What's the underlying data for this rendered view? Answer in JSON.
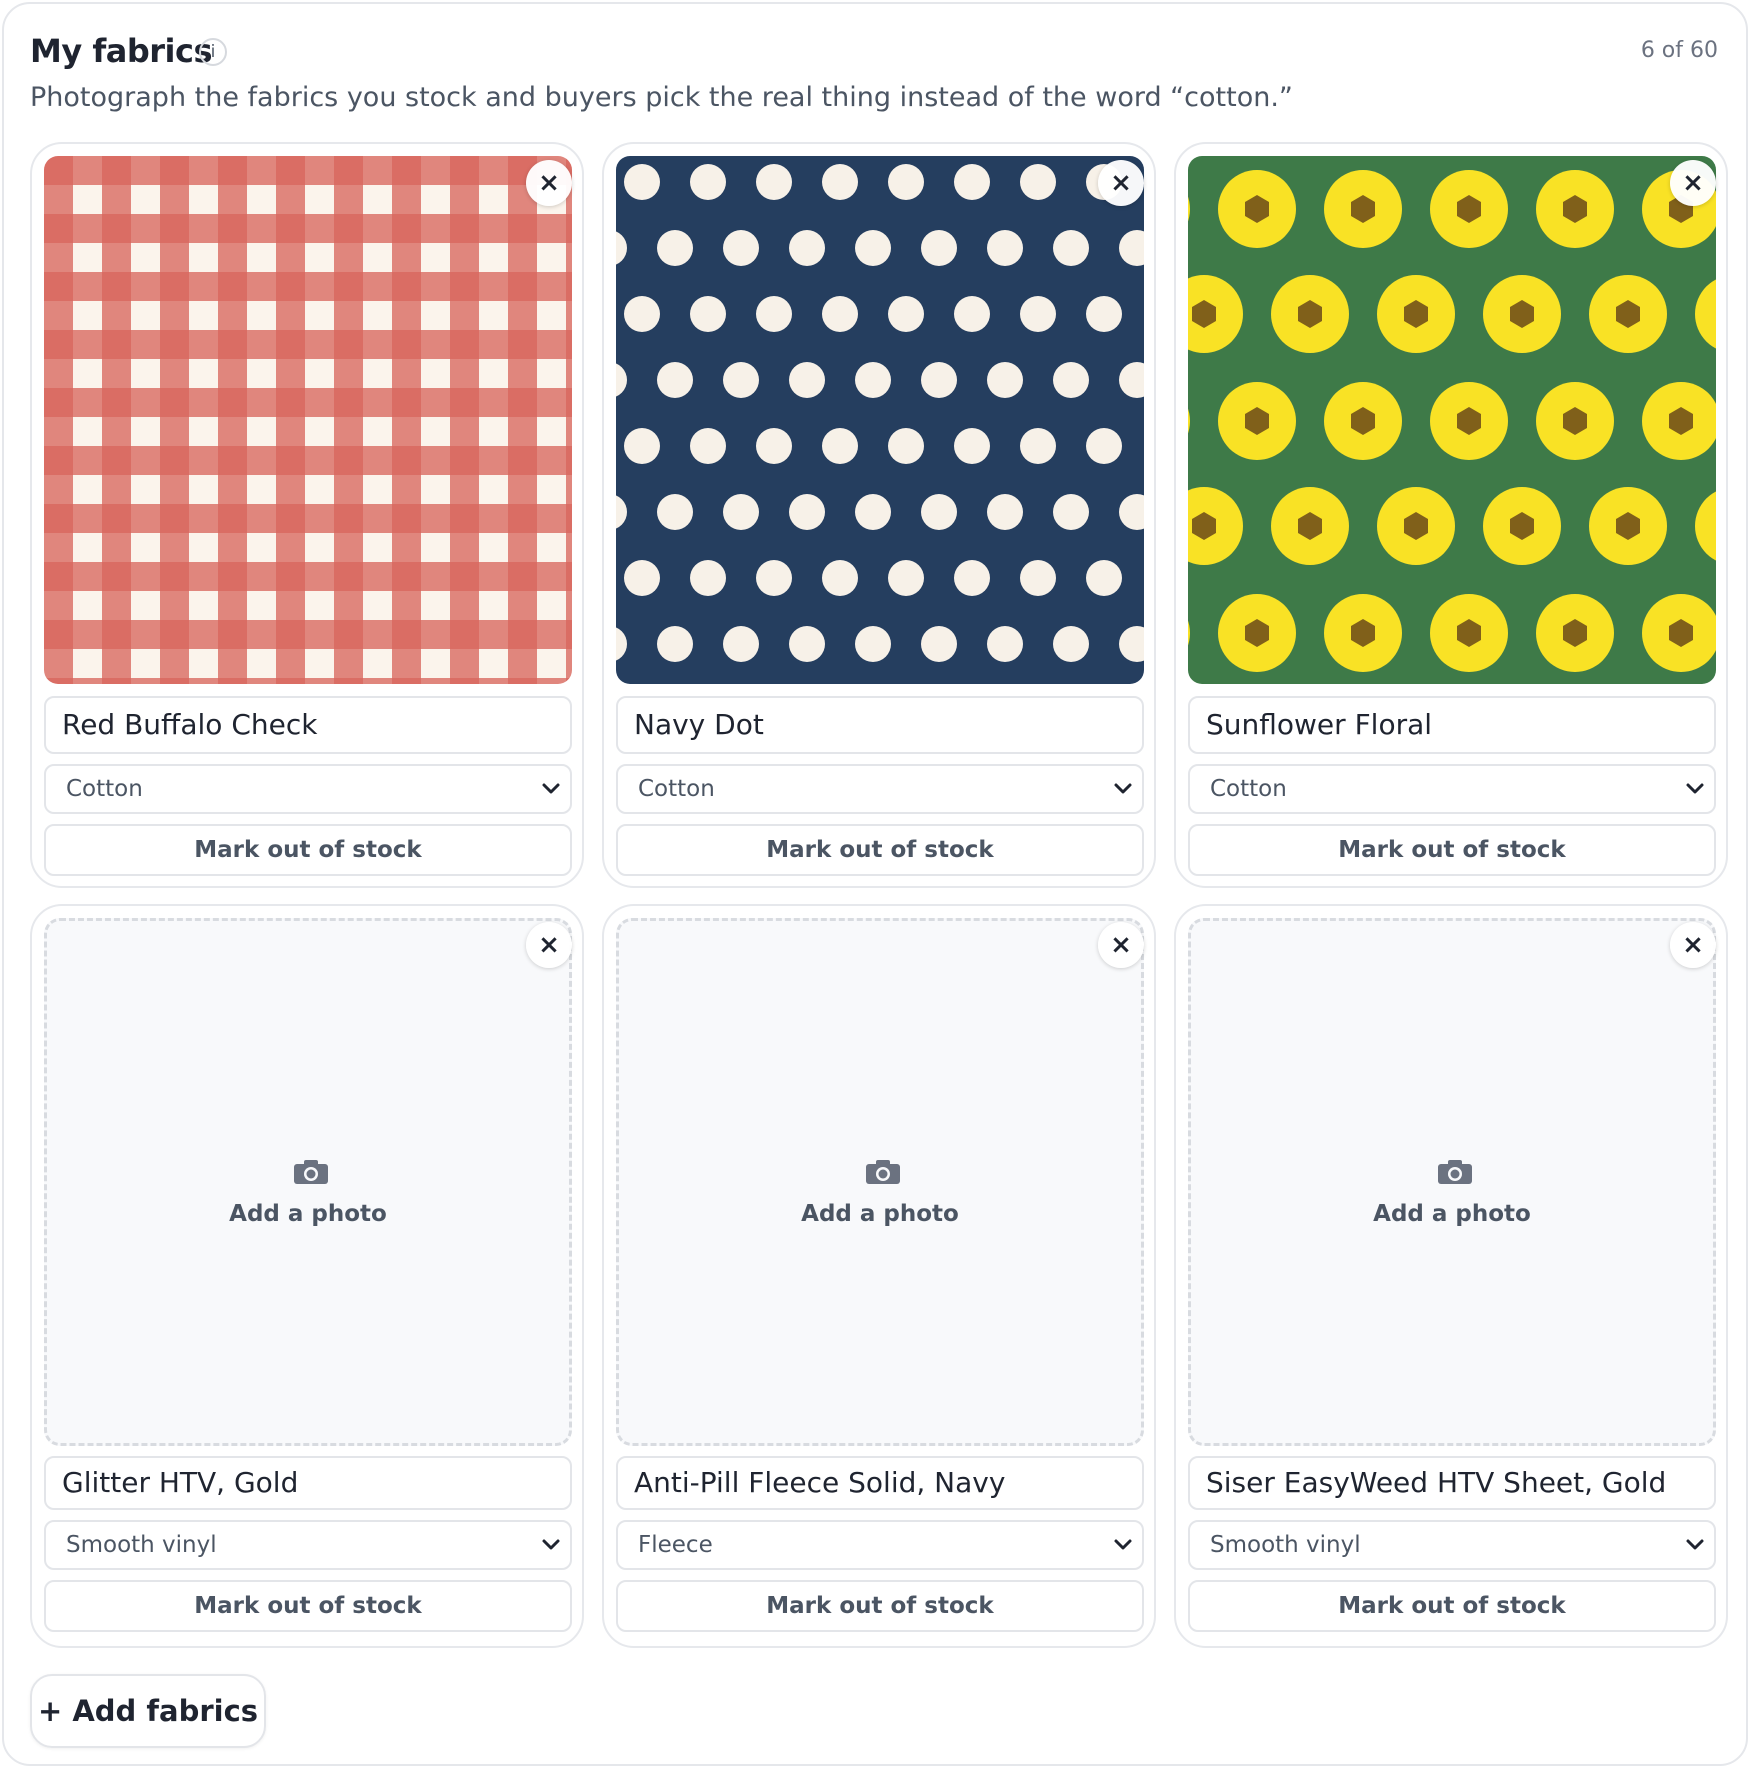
{
  "header": {
    "title": "My fabrics",
    "info_icon": "info-icon",
    "info_glyph": "i",
    "count": "6 of 60",
    "subtitle": "Photograph the fabrics you stock and buyers pick the real thing instead of the word “cotton.”"
  },
  "fabrics": [
    {
      "name": "Red Buffalo Check",
      "material": "Cotton",
      "photo": "red-buffalo-check-swatch",
      "stock_label": "Mark out of stock"
    },
    {
      "name": "Navy Dot",
      "material": "Cotton",
      "photo": "navy-dot-swatch",
      "stock_label": "Mark out of stock"
    },
    {
      "name": "Sunflower Floral",
      "material": "Cotton",
      "photo": "sunflower-floral-swatch",
      "stock_label": "Mark out of stock"
    },
    {
      "name": "Glitter HTV, Gold",
      "material": "Smooth vinyl",
      "photo": null,
      "photo_placeholder": "Add a photo",
      "stock_label": "Mark out of stock"
    },
    {
      "name": "Anti-Pill Fleece Solid, Navy",
      "material": "Fleece",
      "photo": null,
      "photo_placeholder": "Add a photo",
      "stock_label": "Mark out of stock"
    },
    {
      "name": "Siser EasyWeed HTV Sheet, Gold",
      "material": "Smooth vinyl",
      "photo": null,
      "photo_placeholder": "Add a photo",
      "stock_label": "Mark out of stock"
    }
  ],
  "card_icons": {
    "remove": "close-icon",
    "remove_glyph": "×",
    "select": "chevron-down-icon",
    "placeholder": "camera-icon"
  },
  "footer": {
    "add_button": "+ Add fabrics"
  },
  "colors": {
    "gingham_base": "#fbf4ec",
    "gingham_red": "#d9675e",
    "navy": "#253e5f",
    "dot": "#f7f1e8",
    "sunflower_green": "#3e7a48",
    "sunflower_yellow": "#f9e225",
    "sunflower_center": "#80601a"
  }
}
